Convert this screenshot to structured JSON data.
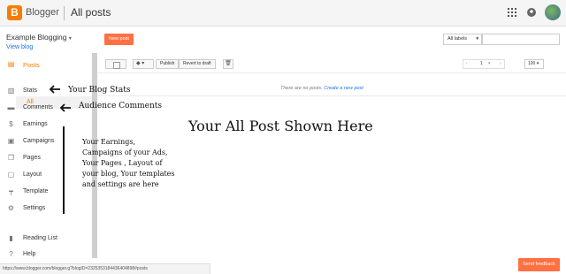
{
  "header": {
    "brand": "Blogger",
    "section": "All posts",
    "icons": [
      "apps-grid-icon",
      "account-circle-icon",
      "user-avatar"
    ]
  },
  "sidebar": {
    "blog_name": "Example Blogging",
    "view_blog": "View blog",
    "items": [
      {
        "label": "Posts",
        "icon": "posts-icon",
        "active": true
      },
      {
        "label": "Stats",
        "icon": "stats-icon"
      },
      {
        "label": "Comments",
        "icon": "comment-icon"
      },
      {
        "label": "Earnings",
        "icon": "dollar-icon"
      },
      {
        "label": "Campaigns",
        "icon": "campaign-icon"
      },
      {
        "label": "Pages",
        "icon": "pages-icon"
      },
      {
        "label": "Layout",
        "icon": "layout-icon"
      },
      {
        "label": "Template",
        "icon": "template-icon"
      },
      {
        "label": "Settings",
        "icon": "gear-icon"
      },
      {
        "label": "Reading List",
        "icon": "bookmark-icon"
      },
      {
        "label": "Help",
        "icon": "help-icon"
      }
    ],
    "sub_all": "All"
  },
  "toolbar": {
    "new_post": "New post",
    "labels_select": "All labels",
    "search_value": ""
  },
  "actions": {
    "publish": "Publish",
    "revert": "Revert to draft",
    "page_number": "1",
    "per_page": "100"
  },
  "empty": {
    "text": "There are no posts.",
    "link": "Create a new post"
  },
  "annotations": {
    "main": "Your All Post Shown Here",
    "stats": "Your Blog Stats",
    "comments": "Audience Comments",
    "note_lines": [
      "Your Earnings,",
      "Campaigns of your Ads,",
      "Your Pages , Layout of",
      "your blog, Your templates",
      "and settings are here"
    ]
  },
  "status_url": "https://www.blogger.com/blogger.g?blogID=2325353184436404898#posts",
  "feedback": "Send feedback",
  "colors": {
    "accent": "#f57d00",
    "button": "#ff7043",
    "link": "#1a73e8"
  }
}
